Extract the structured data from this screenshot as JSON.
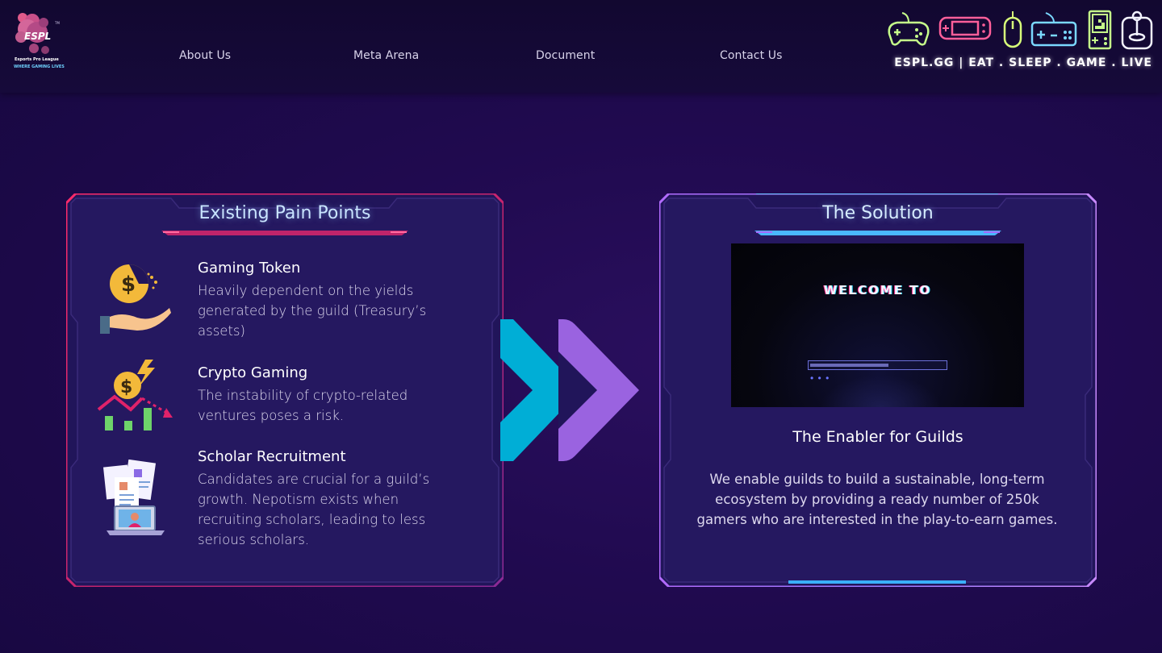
{
  "header": {
    "logo_text": "ESPL",
    "logo_tm": "TM",
    "logo_sub1": "Esports Pro League",
    "logo_sub2": "WHERE GAMING LIVES",
    "nav": [
      {
        "label": "About Us"
      },
      {
        "label": "Meta Arena"
      },
      {
        "label": "Document"
      },
      {
        "label": "Contact Us"
      }
    ],
    "tagline": "ESPL.GG | EAT . SLEEP . GAME . LIVE",
    "gadget_icons": [
      "gamepad-icon",
      "handheld-console-icon",
      "mouse-icon",
      "retro-controller-icon",
      "tetris-handheld-icon",
      "joystick-icon"
    ]
  },
  "pain_points": {
    "title": "Existing Pain Points",
    "items": [
      {
        "icon": "coin-hand-icon",
        "title": "Gaming Token",
        "body": "Heavily dependent on the yields generated by the guild (Treasury’s assets)"
      },
      {
        "icon": "coin-chart-down-icon",
        "title": "Crypto Gaming",
        "body": "The instability of crypto-related ventures poses a risk."
      },
      {
        "icon": "resume-laptop-icon",
        "title": "Scholar Recruitment",
        "body": "Candidates are crucial for a guild’s growth. Nepotism exists when recruiting scholars, leading to less serious scholars."
      }
    ]
  },
  "solution": {
    "title": "The Solution",
    "video": {
      "title": "WELCOME TO",
      "progress": 0.58,
      "dots": "• • •"
    },
    "heading": "The Enabler for Guilds",
    "body": "We enable guilds to build a sustainable, long-term ecosystem by providing a ready number of 250k gamers who are interested in the play-to-earn games."
  },
  "colors": {
    "left_frame": "#e0226a",
    "right_frame": "#b26bff",
    "chevron_1": "#00aed6",
    "chevron_2": "#9a63e0"
  }
}
